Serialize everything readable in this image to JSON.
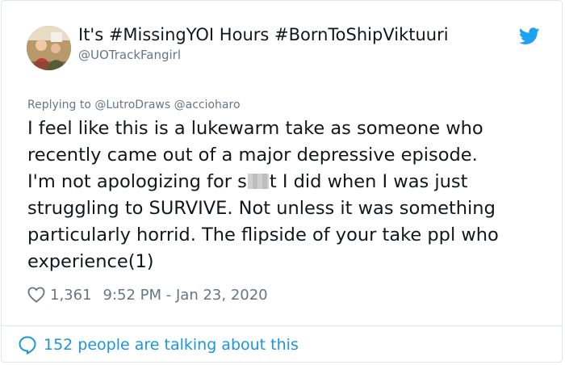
{
  "user": {
    "display_name": "It's #MissingYOI Hours #BornToShipViktuuri",
    "handle": "@UOTrackFangirl"
  },
  "reply": {
    "text": "Replying to @LutroDraws @accioharo"
  },
  "tweet": {
    "line1": "I feel like this is a lukewarm take as someone who",
    "line2": "recently came out of a major depressive episode.",
    "line3_a": "I'm not apologizing for s",
    "line3_b": "t I did when I was just",
    "line4": "struggling to SURVIVE. Not unless it was something",
    "line5": "particularly horrid. The flipside of your take ppl who",
    "line6": "experience(1)"
  },
  "meta": {
    "likes": "1,361",
    "timestamp": "9:52 PM - Jan 23, 2020"
  },
  "footer": {
    "talking": "152 people are talking about this"
  },
  "colors": {
    "twitter_blue": "#1da1f2",
    "link_blue": "#1b95e0",
    "secondary_text": "#657786",
    "primary_text": "#14171a"
  },
  "icons": {
    "brand": "twitter-bird-icon",
    "like": "heart-icon",
    "conversation": "speech-bubble-icon"
  }
}
